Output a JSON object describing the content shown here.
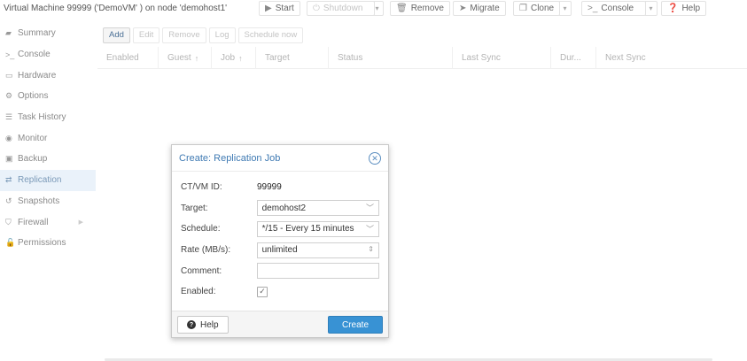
{
  "header": {
    "title": "Virtual Machine 99999 ('DemoVM' ) on node 'demohost1'",
    "buttons": {
      "start": "Start",
      "shutdown": "Shutdown",
      "remove": "Remove",
      "migrate": "Migrate",
      "clone": "Clone",
      "console": "Console",
      "help": "Help"
    }
  },
  "sidebar": {
    "items": [
      {
        "label": "Summary",
        "icon": "summary-icon"
      },
      {
        "label": "Console",
        "icon": "terminal-icon"
      },
      {
        "label": "Hardware",
        "icon": "monitor-icon"
      },
      {
        "label": "Options",
        "icon": "gear-icon"
      },
      {
        "label": "Task History",
        "icon": "list-icon"
      },
      {
        "label": "Monitor",
        "icon": "eye-icon"
      },
      {
        "label": "Backup",
        "icon": "floppy-icon"
      },
      {
        "label": "Replication",
        "icon": "retweet-icon",
        "active": true
      },
      {
        "label": "Snapshots",
        "icon": "history-icon"
      },
      {
        "label": "Firewall",
        "icon": "shield-icon"
      },
      {
        "label": "Permissions",
        "icon": "unlock-icon"
      }
    ]
  },
  "toolbar": {
    "add": "Add",
    "edit": "Edit",
    "remove": "Remove",
    "log": "Log",
    "schedule_now": "Schedule now"
  },
  "grid": {
    "columns": [
      "Enabled",
      "Guest",
      "Job",
      "Target",
      "Status",
      "Last Sync",
      "Dur...",
      "Next Sync"
    ]
  },
  "dialog": {
    "title": "Create: Replication Job",
    "fields": {
      "ctvm_label": "CT/VM ID:",
      "ctvm_value": "99999",
      "target_label": "Target:",
      "target_value": "demohost2",
      "schedule_label": "Schedule:",
      "schedule_value": "*/15 - Every 15 minutes",
      "rate_label": "Rate (MB/s):",
      "rate_value": "unlimited",
      "comment_label": "Comment:",
      "comment_value": "",
      "enabled_label": "Enabled:",
      "enabled_checked": true
    },
    "help": "Help",
    "create": "Create"
  },
  "colors": {
    "accent": "#3892d4",
    "title_blue": "#3f7ab3",
    "active_bg": "#eaf2fa"
  }
}
